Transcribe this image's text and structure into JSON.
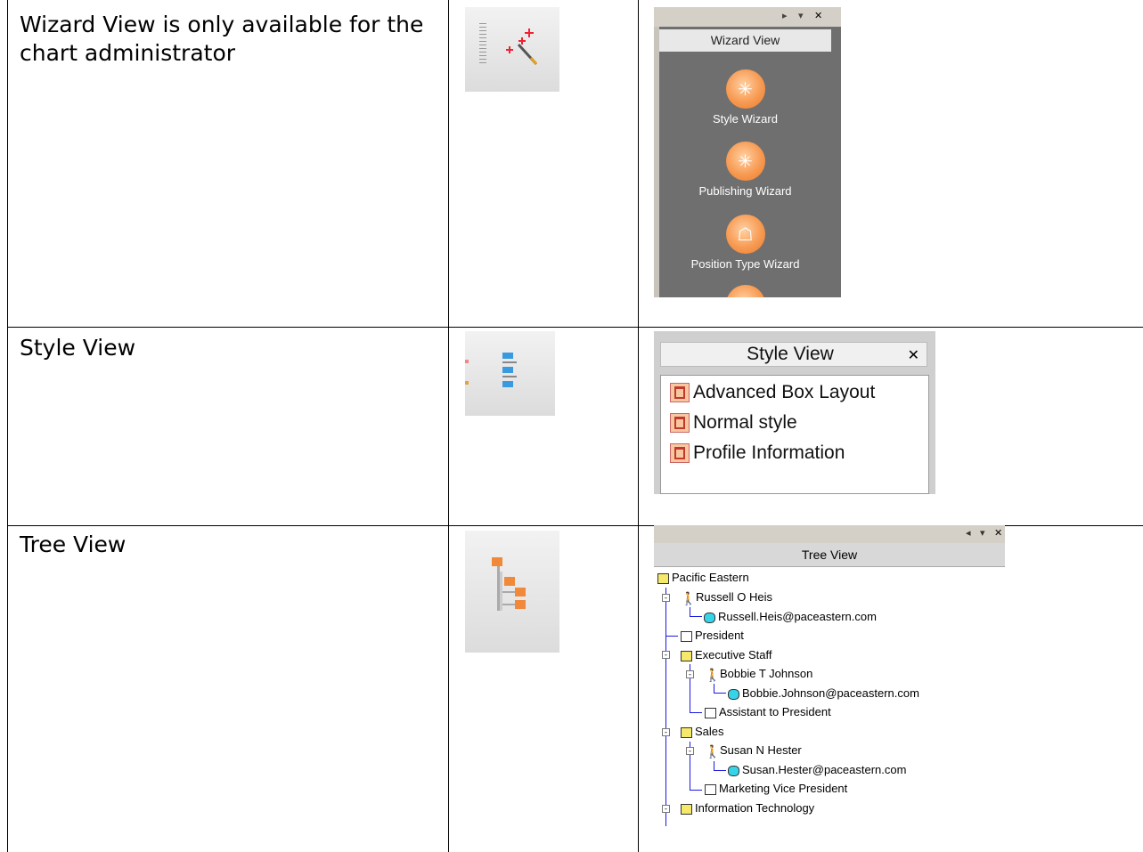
{
  "rows": [
    {
      "description": "Wizard View is only available for the chart administrator"
    },
    {
      "description": "Style View"
    },
    {
      "description": "Tree View"
    }
  ],
  "wizard_view": {
    "title": "Wizard View",
    "controls": [
      "▸",
      "▾",
      "✕"
    ],
    "items": [
      {
        "label": "Style Wizard",
        "icon": "style-wizard-icon",
        "glyph": "✳"
      },
      {
        "label": "Publishing Wizard",
        "icon": "publishing-wizard-icon",
        "glyph": "✳"
      },
      {
        "label": "Position Type Wizard",
        "icon": "position-type-wizard-icon",
        "glyph": "☖"
      }
    ],
    "accent": "#f28c3d",
    "panel_bg": "#6f6f6f"
  },
  "style_view": {
    "title": "Style View",
    "close": "✕",
    "items": [
      "Advanced Box Layout",
      "Normal style",
      "Profile Information"
    ]
  },
  "tree_view": {
    "title": "Tree View",
    "controls": [
      "◂",
      "▾",
      "✕"
    ],
    "nodes": [
      {
        "label": "Pacific Eastern",
        "type": "folder"
      },
      {
        "label": "Russell O Heis",
        "type": "person"
      },
      {
        "label": "Russell.Heis@paceastern.com",
        "type": "db"
      },
      {
        "label": "President",
        "type": "position"
      },
      {
        "label": "Executive Staff",
        "type": "folder"
      },
      {
        "label": "Bobbie T Johnson",
        "type": "person"
      },
      {
        "label": "Bobbie.Johnson@paceastern.com",
        "type": "db"
      },
      {
        "label": "Assistant to President",
        "type": "position"
      },
      {
        "label": "Sales",
        "type": "folder"
      },
      {
        "label": "Susan N Hester",
        "type": "person"
      },
      {
        "label": "Susan.Hester@paceastern.com",
        "type": "db"
      },
      {
        "label": "Marketing Vice President",
        "type": "position"
      },
      {
        "label": "Information Technology",
        "type": "folder"
      }
    ],
    "line_color": "#1a1ae0"
  }
}
